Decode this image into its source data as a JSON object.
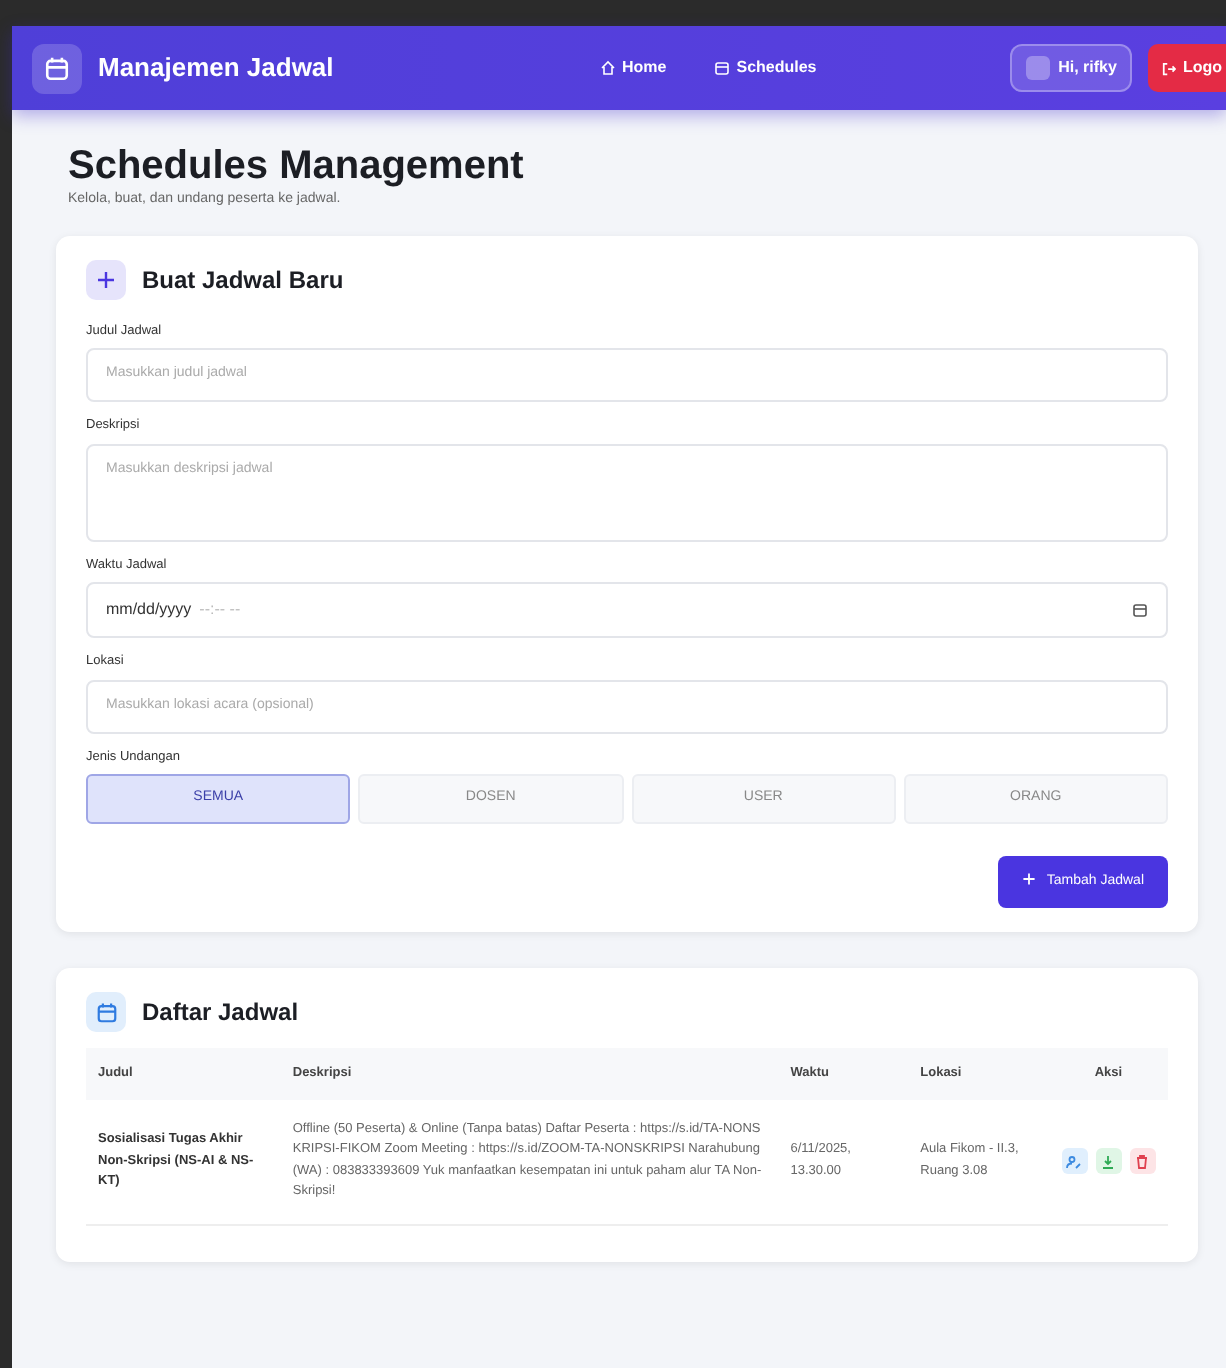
{
  "navbar": {
    "brand": "Manajemen Jadwal",
    "links": [
      {
        "label": "Home"
      },
      {
        "label": "Schedules"
      }
    ],
    "user": "Hi, rifky",
    "logout": "Logo"
  },
  "page": {
    "title": "Schedules Management",
    "subtitle": "Kelola, buat, dan undang peserta ke jadwal."
  },
  "form": {
    "title": "Buat Jadwal Baru",
    "fields": [
      {
        "kind": "text",
        "label": "Judul Jadwal",
        "placeholder": "Masukkan judul jadwal"
      },
      {
        "kind": "textarea",
        "label": "Deskripsi",
        "placeholder": "Masukkan deskripsi jadwal"
      },
      {
        "kind": "datetime",
        "label": "Waktu Jadwal",
        "date_part": "mm/dd/yyyy",
        "time_part": "--:-- --"
      },
      {
        "kind": "text",
        "label": "Lokasi",
        "placeholder": "Masukkan lokasi acara (opsional)"
      }
    ],
    "invite_label": "Jenis Undangan",
    "invite_types": [
      {
        "label": "SEMUA",
        "selected": true
      },
      {
        "label": "DOSEN",
        "selected": false
      },
      {
        "label": "USER",
        "selected": false
      },
      {
        "label": "ORANG",
        "selected": false
      }
    ],
    "submit": "Tambah Jadwal"
  },
  "list": {
    "title": "Daftar Jadwal",
    "columns": [
      "Judul",
      "Deskripsi",
      "Waktu",
      "Lokasi",
      "Aksi"
    ],
    "rows": [
      {
        "judul": "Sosialisasi Tugas Akhir Non-Skripsi (NS-AI & NS-KT)",
        "deskripsi": "Offline (50 Peserta) & Online (Tanpa batas) Daftar Peserta : https://s.id/TA-NONSKRIPSI-FIKOM Zoom Meeting : https://s.id/ZOOM-TA-NONSKRIPSI Narahubung(WA) : 083833393609 Yuk manfaatkan kesempatan ini untuk paham alur TA Non-Skripsi!",
        "waktu": "6/11/2025, 13.30.00",
        "lokasi": "Aula Fikom - II.3, Ruang 3.08"
      }
    ]
  }
}
